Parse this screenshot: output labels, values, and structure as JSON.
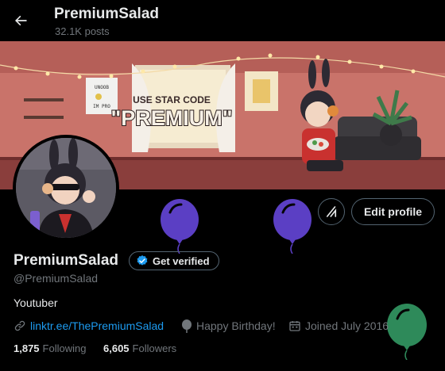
{
  "header": {
    "title": "PremiumSalad",
    "post_count": "32.1K posts"
  },
  "banner": {
    "sign_line1": "USE STAR CODE",
    "sign_line2": "\"PREMIUM\"",
    "poster_line1": "UNOOB",
    "poster_line2": "IM PRO"
  },
  "actions": {
    "edit_profile": "Edit profile"
  },
  "profile": {
    "display_name": "PremiumSalad",
    "get_verified": "Get verified",
    "handle": "@PremiumSalad",
    "bio": "Youtuber",
    "link": "linktr.ee/ThePremiumSalad",
    "birthday": "Happy Birthday!",
    "joined": "Joined July 2016"
  },
  "stats": {
    "following_count": "1,875",
    "following_label": "Following",
    "followers_count": "6,605",
    "followers_label": "Followers"
  },
  "icons": {
    "back": "arrow-left-icon",
    "grok": "grok-icon",
    "verified": "verified-badge-icon",
    "link": "link-icon",
    "birthday": "balloon-icon",
    "calendar": "calendar-icon"
  },
  "colors": {
    "background": "#000000",
    "text_primary": "#e7e9ea",
    "text_secondary": "#71767b",
    "link": "#1d9bf0",
    "verified": "#1d9bf0",
    "balloon_purple": "#5b3fc4",
    "balloon_green": "#2e8a5a"
  }
}
